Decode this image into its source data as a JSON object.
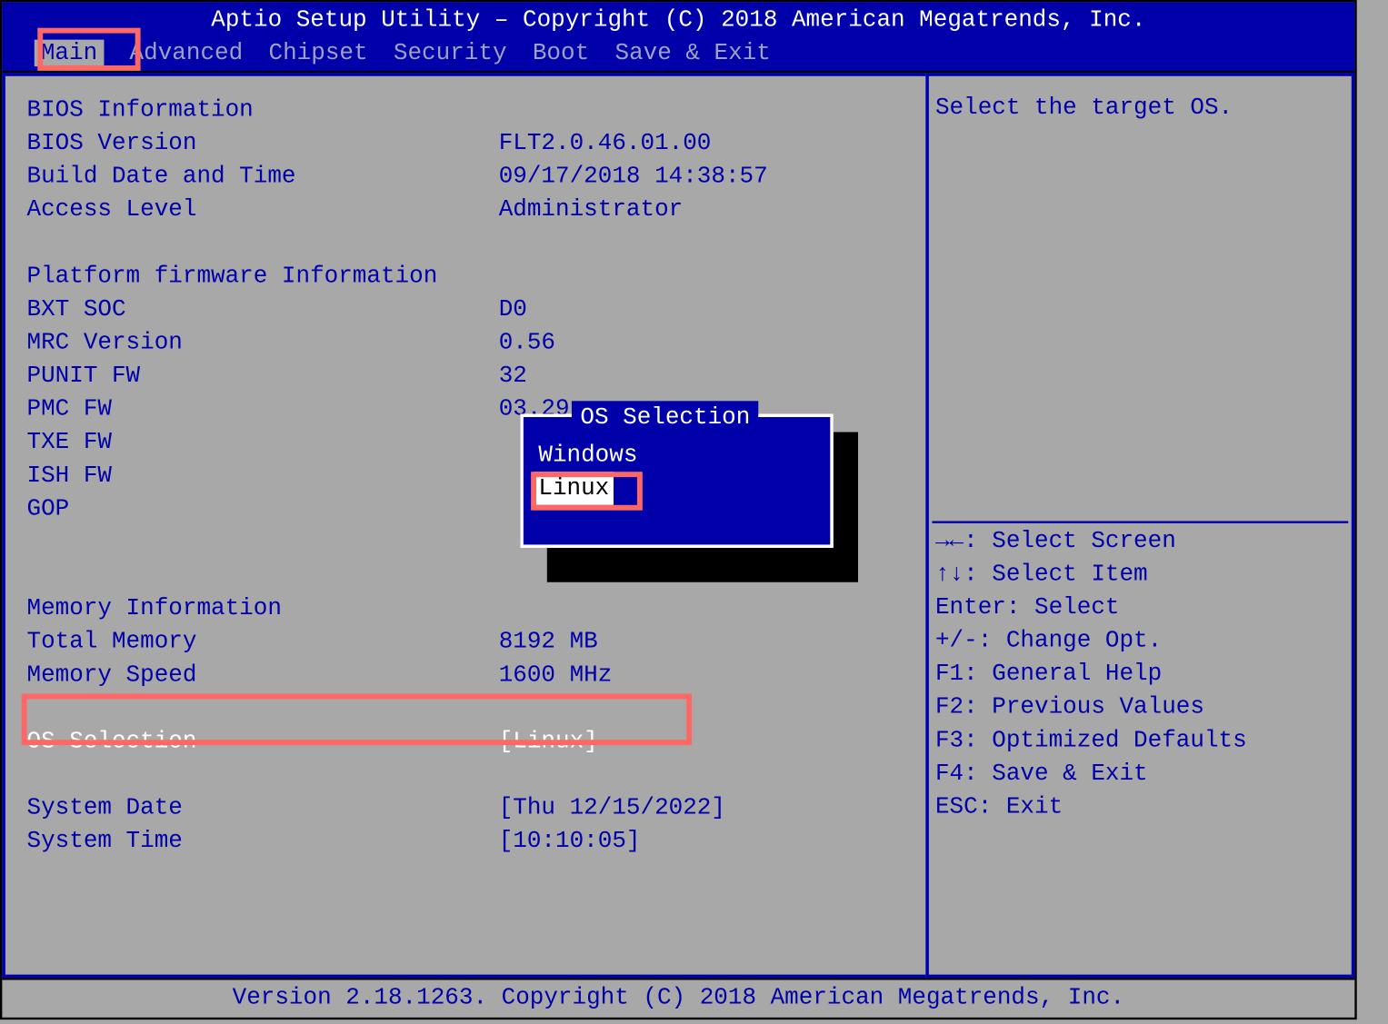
{
  "header": {
    "title": "Aptio Setup Utility – Copyright (C) 2018 American Megatrends, Inc.",
    "tabs": [
      "Main",
      "Advanced",
      "Chipset",
      "Security",
      "Boot",
      "Save & Exit"
    ],
    "active_tab": "Main"
  },
  "main": {
    "sections": {
      "bios_info_heading": "BIOS Information",
      "bios_version_label": "BIOS Version",
      "bios_version_value": "FLT2.0.46.01.00",
      "build_date_label": "Build Date and Time",
      "build_date_value": "09/17/2018 14:38:57",
      "access_level_label": "Access Level",
      "access_level_value": "Administrator",
      "platform_heading": "Platform firmware Information",
      "bxt_soc_label": "BXT SOC",
      "bxt_soc_value": "D0",
      "mrc_label": "MRC Version",
      "mrc_value": "0.56",
      "punit_label": "PUNIT FW",
      "punit_value": "32",
      "pmc_label": "PMC FW",
      "pmc_value": "03.29",
      "txe_label": "TXE FW",
      "txe_value": "",
      "ish_label": "ISH FW",
      "ish_value": "",
      "gop_label": "GOP",
      "gop_value": "",
      "memory_heading": "Memory Information",
      "total_mem_label": "Total Memory",
      "total_mem_value": "8192 MB",
      "mem_speed_label": "Memory Speed",
      "mem_speed_value": "1600 MHz",
      "os_selection_label": "OS Selection",
      "os_selection_value": "[Linux]",
      "system_date_label": "System Date",
      "system_date_value": "[Thu 12/15/2022]",
      "system_time_label": "System Time",
      "system_time_value": "[10:10:05]"
    }
  },
  "popup": {
    "title": " OS Selection ",
    "options": [
      "Windows",
      "Linux"
    ],
    "selected": "Linux"
  },
  "right": {
    "help_text": "Select the target OS.",
    "keys": [
      "→←: Select Screen",
      "↑↓: Select Item",
      "Enter: Select",
      "+/-: Change Opt.",
      "F1: General Help",
      "F2: Previous Values",
      "F3: Optimized Defaults",
      "F4: Save & Exit",
      "ESC: Exit"
    ]
  },
  "footer": {
    "text": "Version 2.18.1263. Copyright (C) 2018 American Megatrends, Inc."
  }
}
